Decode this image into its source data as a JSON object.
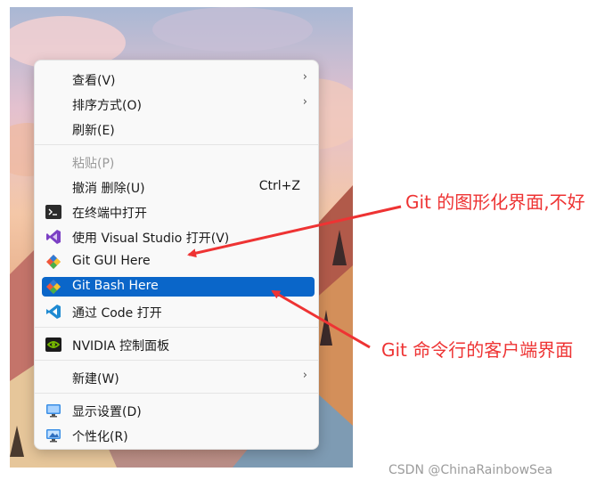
{
  "menu": {
    "items": [
      {
        "label": "查看(V)",
        "submenu_icon": "chevron-right-icon"
      },
      {
        "label": "排序方式(O)",
        "submenu_icon": "chevron-right-icon"
      },
      {
        "label": "刷新(E)"
      },
      {
        "label": "粘贴(P)",
        "disabled": true
      },
      {
        "label": "撤消 删除(U)",
        "shortcut": "Ctrl+Z"
      },
      {
        "label": "在终端中打开",
        "icon": "terminal-icon"
      },
      {
        "label": "使用 Visual Studio 打开(V)",
        "icon": "visual-studio-icon"
      },
      {
        "label": "Git GUI Here",
        "icon": "git-icon"
      },
      {
        "label": "Git Bash Here",
        "icon": "git-icon",
        "selected": true
      },
      {
        "label": "通过 Code 打开",
        "icon": "vscode-icon"
      },
      {
        "label": "NVIDIA 控制面板",
        "icon": "nvidia-icon"
      },
      {
        "label": "新建(W)",
        "submenu_icon": "chevron-right-icon"
      },
      {
        "label": "显示设置(D)",
        "icon": "display-settings-icon"
      },
      {
        "label": "个性化(R)",
        "icon": "personalize-icon"
      }
    ]
  },
  "annotations": {
    "gui_note": "Git 的图形化界面,不好",
    "bash_note": "Git 命令行的客户端界面",
    "color": "#ee3333"
  },
  "colors": {
    "selection": "#0a66c9",
    "menu_bg": "#f9f9f9"
  },
  "watermark": "CSDN @ChinaRainbowSea"
}
